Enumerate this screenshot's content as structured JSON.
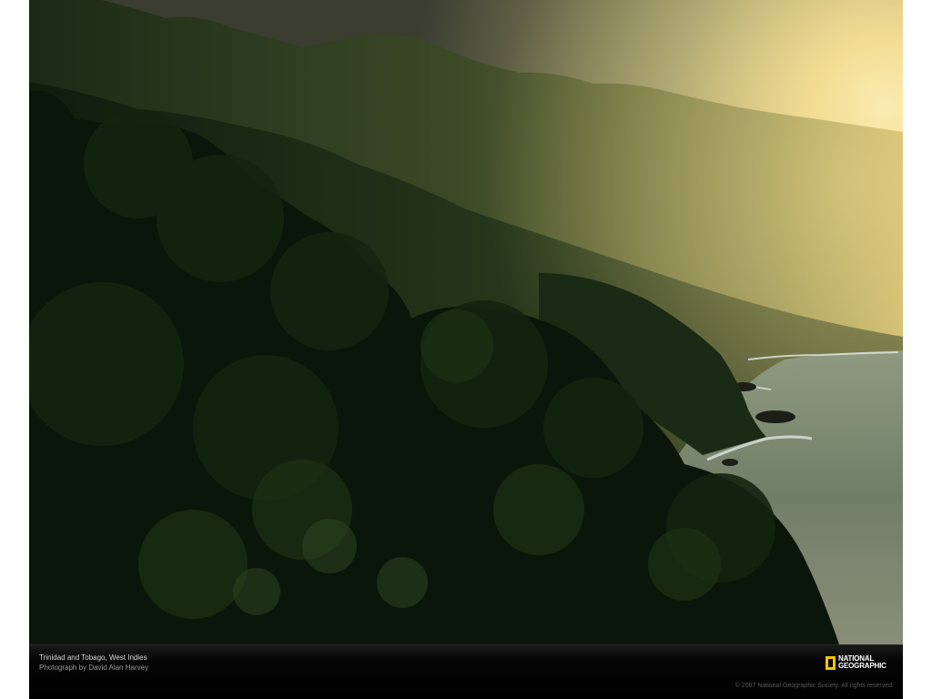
{
  "photo": {
    "subject": "Trinidad and Tobago, West Indies",
    "colors": {
      "sky_glow": "#f4e3a0",
      "sky_dark": "#4d5140",
      "ridge": "#3a4a2a",
      "forest_dark": "#0d1a0b",
      "sea": "#7c8a74"
    }
  },
  "caption": {
    "title": "Trinidad and Tobago, West Indies",
    "credit": "Photograph by David Alan Harvey"
  },
  "logo": {
    "line1": "NATIONAL",
    "line2": "GEOGRAPHIC",
    "border_color": "#f5c400"
  },
  "copyright": "© 2007 National Geographic Society. All rights reserved."
}
